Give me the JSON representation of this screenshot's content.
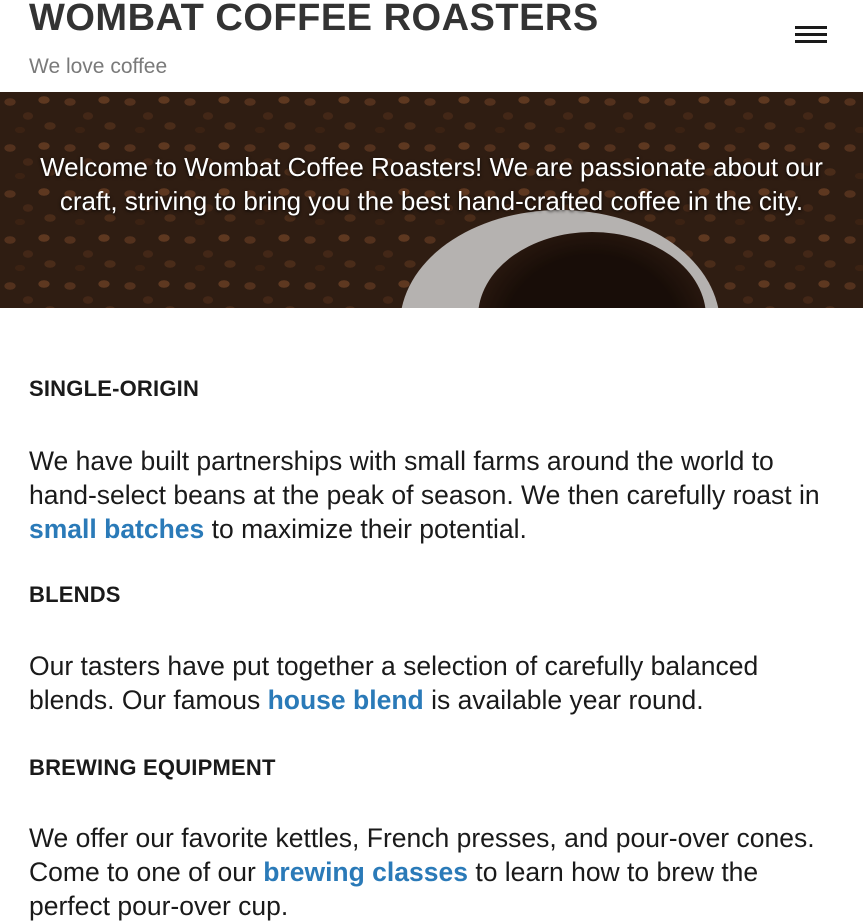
{
  "header": {
    "title": "WOMBAT COFFEE ROASTERS",
    "tagline": "We love coffee",
    "menu_icon": "hamburger-menu-icon"
  },
  "hero": {
    "text": "Welcome to Wombat Coffee Roasters! We are passionate about our craft, striving to bring you the best hand-crafted coffee in the city."
  },
  "sections": [
    {
      "heading": "SINGLE-ORIGIN",
      "before": "We have built partnerships with small farms around the world to hand-select beans at the peak of season. We then carefully roast in ",
      "link": "small batches",
      "after": " to maximize their potential."
    },
    {
      "heading": "BLENDS",
      "before": "Our tasters have put together a selection of carefully balanced blends. Our famous ",
      "link": "house blend",
      "after": " is available year round."
    },
    {
      "heading": "BREWING EQUIPMENT",
      "before": "We offer our favorite kettles, French presses, and pour-over cones. Come to one of our ",
      "link": "brewing classes",
      "after": " to learn how to brew the perfect pour-over cup."
    }
  ],
  "colors": {
    "link": "#2a7ab8",
    "title": "#333333",
    "tagline": "#7a7a7a"
  }
}
